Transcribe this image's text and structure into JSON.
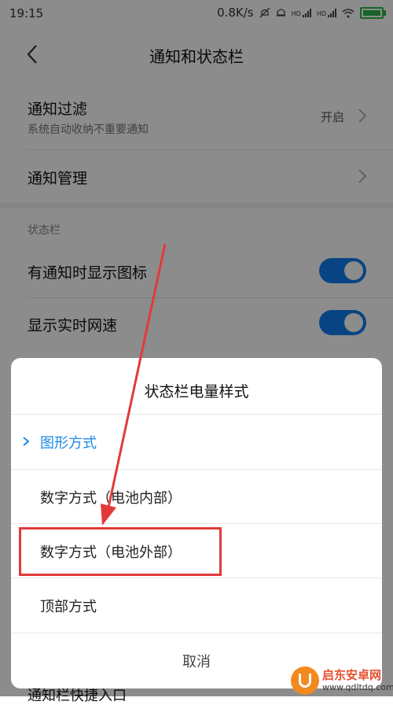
{
  "status_bar": {
    "time": "19:15",
    "speed": "0.8K/s",
    "signal_label_1": "HD",
    "signal_label_2": "HD"
  },
  "header": {
    "title": "通知和状态栏"
  },
  "settings": {
    "notification_filter": {
      "label": "通知过滤",
      "sub": "系统自动收纳不重要通知",
      "value": "开启"
    },
    "notification_manage": {
      "label": "通知管理"
    },
    "section_status_bar": "状态栏",
    "show_icon_on_notify": {
      "label": "有通知时显示图标",
      "on": true
    },
    "show_net_speed": {
      "label": "显示实时网速",
      "on": true
    },
    "below_dialog_label": "通知栏快捷入口"
  },
  "dialog": {
    "title": "状态栏电量样式",
    "options": [
      {
        "label": "图形方式",
        "selected": true
      },
      {
        "label": "数字方式（电池内部）",
        "selected": false
      },
      {
        "label": "数字方式（电池外部）",
        "selected": false
      },
      {
        "label": "顶部方式",
        "selected": false
      }
    ],
    "cancel": "取消"
  },
  "watermark": {
    "name": "启东安卓网",
    "url": "www.qdltdq.com"
  },
  "colors": {
    "accent": "#1f8ae6",
    "toggle_on": "#0f7cf0",
    "highlight_box": "#e23a3a",
    "battery": "#2bb84a"
  }
}
